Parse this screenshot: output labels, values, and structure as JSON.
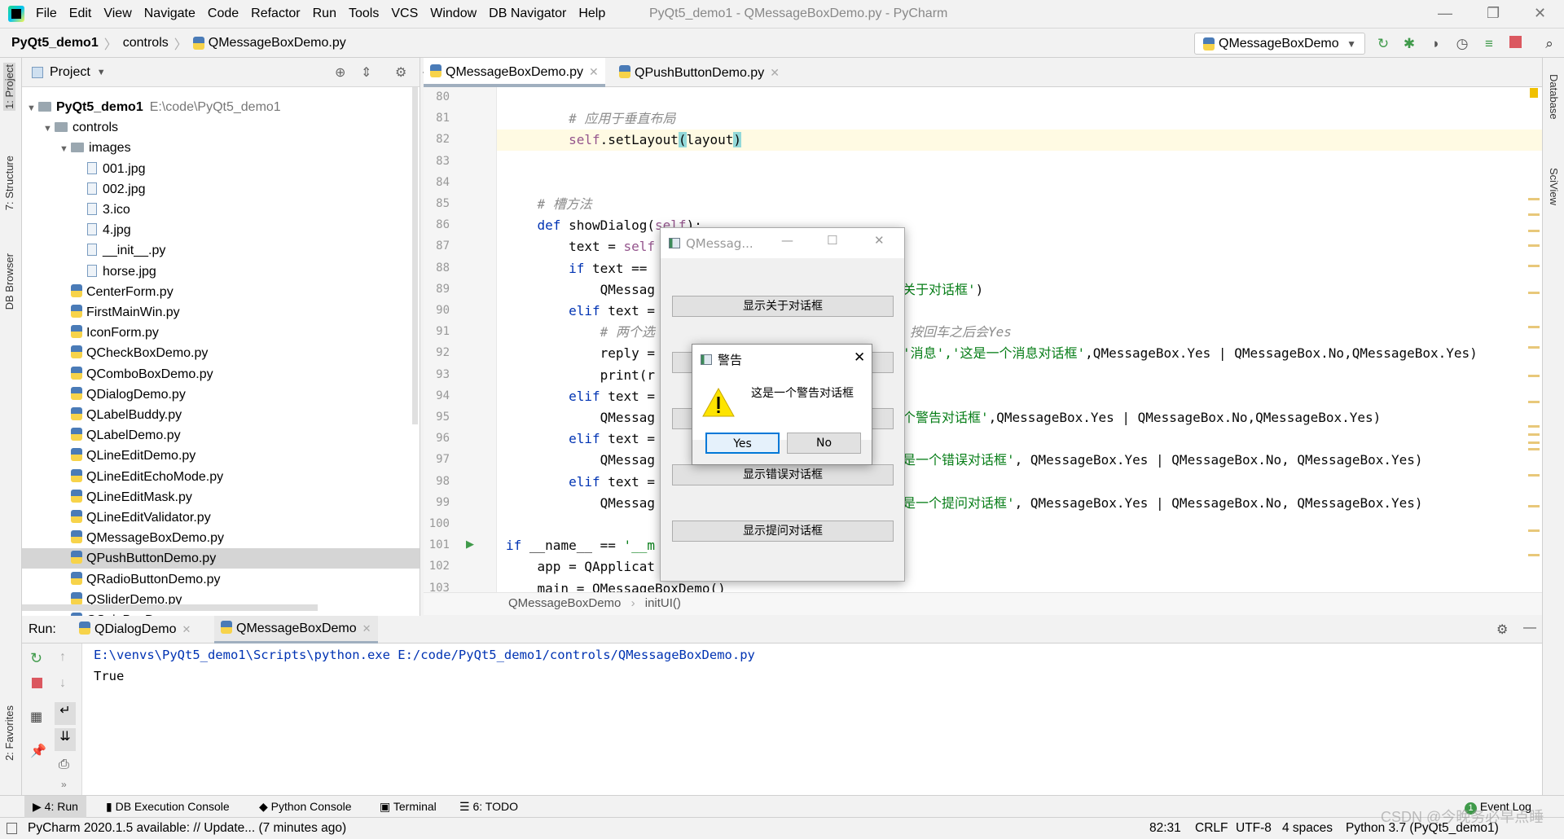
{
  "menu": {
    "items": [
      "File",
      "Edit",
      "View",
      "Navigate",
      "Code",
      "Refactor",
      "Run",
      "Tools",
      "VCS",
      "Window",
      "DB Navigator",
      "Help"
    ],
    "window_title": "PyQt5_demo1 - QMessageBoxDemo.py - PyCharm"
  },
  "breadcrumb": {
    "project": "PyQt5_demo1",
    "folder": "controls",
    "file": "QMessageBoxDemo.py"
  },
  "run_config": {
    "name": "QMessageBoxDemo",
    "stop_badge": "2"
  },
  "left_strip": {
    "project": "1: Project",
    "structure": "7: Structure",
    "db_browser": "DB Browser",
    "favorites": "2: Favorites"
  },
  "right_strip": {
    "database": "Database",
    "sciview": "SciView"
  },
  "project_panel": {
    "title": "Project",
    "root": {
      "name": "PyQt5_demo1",
      "path": "E:\\code\\PyQt5_demo1"
    },
    "folders": [
      "controls",
      "images"
    ],
    "images": [
      "001.jpg",
      "002.jpg",
      "3.ico",
      "4.jpg",
      "__init__.py",
      "horse.jpg"
    ],
    "files": [
      "CenterForm.py",
      "FirstMainWin.py",
      "IconForm.py",
      "QCheckBoxDemo.py",
      "QComboBoxDemo.py",
      "QDialogDemo.py",
      "QLabelBuddy.py",
      "QLabelDemo.py",
      "QLineEditDemo.py",
      "QLineEditEchoMode.py",
      "QLineEditMask.py",
      "QLineEditValidator.py",
      "QMessageBoxDemo.py",
      "QPushButtonDemo.py",
      "QRadioButtonDemo.py",
      "QSliderDemo.py",
      "QSpinBoxDemo.py"
    ],
    "selected": "QPushButtonDemo.py"
  },
  "editor": {
    "tabs": [
      "QMessageBoxDemo.py",
      "QPushButtonDemo.py"
    ],
    "active_tab": 0,
    "first_line": 80,
    "current_line": 82,
    "lines": [
      [],
      [
        [
          "        ",
          "id"
        ],
        [
          "# 应用于垂直布局",
          "cm"
        ]
      ],
      [
        [
          "        ",
          "id"
        ],
        [
          "self",
          "sf"
        ],
        [
          ".setLayout",
          "id"
        ],
        [
          "(",
          "brk"
        ],
        [
          "layout",
          "id"
        ],
        [
          ")",
          "brk"
        ]
      ],
      [],
      [],
      [
        [
          "    ",
          "id"
        ],
        [
          "# 槽方法",
          "cm"
        ]
      ],
      [
        [
          "    ",
          "id"
        ],
        [
          "def ",
          "kw"
        ],
        [
          "showDialog(",
          "id"
        ],
        [
          "self",
          "sf"
        ],
        [
          "):",
          "id"
        ]
      ],
      [
        [
          "        text = ",
          "id"
        ],
        [
          "self",
          "sf"
        ]
      ],
      [
        [
          "        ",
          "id"
        ],
        [
          "if ",
          "kw"
        ],
        [
          "text == ",
          "id"
        ]
      ],
      [
        [
          "            QMessag",
          "id"
        ]
      ],
      [
        [
          "        ",
          "id"
        ],
        [
          "elif ",
          "kw"
        ],
        [
          "text =",
          "id"
        ]
      ],
      [
        [
          "            ",
          "id"
        ],
        [
          "# 两个选",
          "cm"
        ]
      ],
      [
        [
          "            reply =",
          "id"
        ]
      ],
      [
        [
          "            print(r",
          "id"
        ]
      ],
      [
        [
          "        ",
          "id"
        ],
        [
          "elif ",
          "kw"
        ],
        [
          "text =",
          "id"
        ]
      ],
      [
        [
          "            QMessag",
          "id"
        ]
      ],
      [
        [
          "        ",
          "id"
        ],
        [
          "elif ",
          "kw"
        ],
        [
          "text =",
          "id"
        ]
      ],
      [
        [
          "            QMessag",
          "id"
        ]
      ],
      [
        [
          "        ",
          "id"
        ],
        [
          "elif ",
          "kw"
        ],
        [
          "text =",
          "id"
        ]
      ],
      [
        [
          "            QMessag",
          "id"
        ]
      ],
      [],
      [
        [
          "if ",
          "kw"
        ],
        [
          "__name__ == ",
          "id"
        ],
        [
          "'__m",
          "st"
        ]
      ],
      [
        [
          "    app = QApplicat",
          "id"
        ]
      ],
      [
        [
          "    main = QMessageBoxDemo()",
          "id"
        ]
      ]
    ],
    "right_parts": [
      {
        "line": 89,
        "segs": [
          [
            "关于对话框'",
            "st"
          ],
          [
            ")",
            "id"
          ]
        ]
      },
      {
        "line": 91,
        "segs": [
          [
            "按回车之后会Yes",
            "cm"
          ]
        ]
      },
      {
        "line": 92,
        "segs": [
          [
            "'消息','这是一个消息对话框'",
            "st"
          ],
          [
            ",QMessageBox.Yes | QMessageBox.No,QMessageBox.Yes)",
            "id"
          ]
        ]
      },
      {
        "line": 95,
        "segs": [
          [
            "个警告对话框'",
            "st"
          ],
          [
            ",QMessageBox.Yes | QMessageBox.No,QMessageBox.Yes)",
            "id"
          ]
        ]
      },
      {
        "line": 97,
        "segs": [
          [
            "是一个错误对话框'",
            "st"
          ],
          [
            ", QMessageBox.Yes | QMessageBox.No, QMessageBox.Yes)",
            "id"
          ]
        ]
      },
      {
        "line": 99,
        "segs": [
          [
            "是一个提问对话框'",
            "st"
          ],
          [
            ", QMessageBox.Yes | QMessageBox.No, QMessageBox.Yes)",
            "id"
          ]
        ]
      }
    ],
    "crumb": [
      "QMessageBoxDemo",
      "initUI()"
    ]
  },
  "run": {
    "label": "Run:",
    "tabs": [
      "QDialogDemo",
      "QMessageBoxDemo"
    ],
    "active_tab": 1,
    "output": [
      "E:\\venvs\\PyQt5_demo1\\Scripts\\python.exe E:/code/PyQt5_demo1/controls/QMessageBoxDemo.py",
      "True"
    ]
  },
  "bottom_tabs": [
    "4: Run",
    "DB Execution Console",
    "Python Console",
    "Terminal",
    "6: TODO"
  ],
  "event_log": {
    "label": "Event Log",
    "count": "1"
  },
  "status": {
    "message": "PyCharm 2020.1.5 available: // Update... (7 minutes ago)",
    "position": "82:31",
    "line_sep": "CRLF",
    "encoding": "UTF-8",
    "indent": "4 spaces",
    "interpreter": "Python 3.7 (PyQt5_demo1)",
    "watermark": "CSDN @今晚务必早点睡"
  },
  "app_window": {
    "title": "QMessag...",
    "buttons": [
      "显示关于对话框",
      "",
      "",
      "显示错误对话框",
      "显示提问对话框"
    ]
  },
  "warning_box": {
    "title": "警告",
    "message": "这是一个警告对话框",
    "yes": "Yes",
    "no": "No",
    "icon": "warning-icon"
  },
  "colors": {
    "keyword": "#0033b3",
    "self": "#94558d",
    "string": "#067d17",
    "comment": "#8c8c8c",
    "current_line": "#fffae3"
  }
}
